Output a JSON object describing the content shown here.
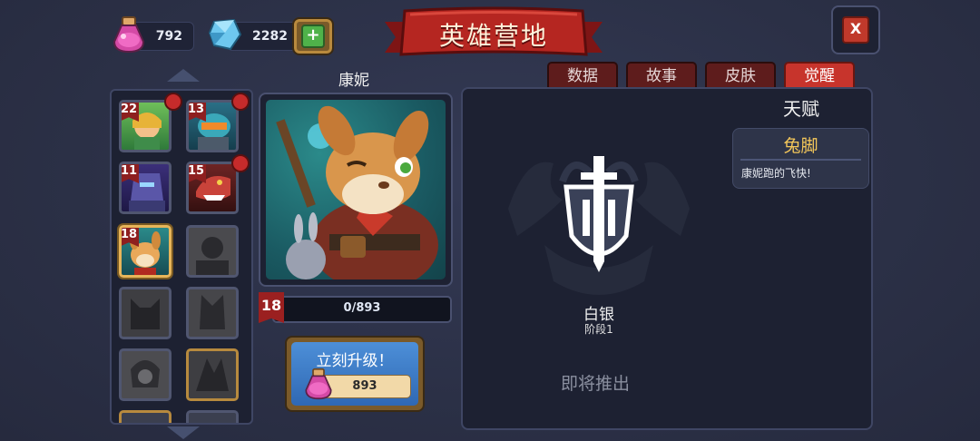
{
  "header": {
    "title": "英雄营地",
    "close_label": "X"
  },
  "currency": {
    "potion": {
      "value": "792",
      "icon": "potion-icon"
    },
    "gem": {
      "value": "2282",
      "icon": "gem-icon"
    },
    "add_label": "+"
  },
  "hero_list": {
    "slots": [
      {
        "level": "22",
        "badge": true,
        "state": "unlocked"
      },
      {
        "level": "13",
        "badge": true,
        "state": "unlocked"
      },
      {
        "level": "11",
        "badge": false,
        "state": "unlocked"
      },
      {
        "level": "15",
        "badge": true,
        "state": "unlocked"
      },
      {
        "level": "18",
        "badge": false,
        "state": "selected"
      },
      {
        "level": "",
        "badge": false,
        "state": "locked"
      },
      {
        "level": "",
        "badge": false,
        "state": "locked"
      },
      {
        "level": "",
        "badge": false,
        "state": "locked"
      },
      {
        "level": "",
        "badge": false,
        "state": "locked"
      },
      {
        "level": "",
        "badge": false,
        "state": "locked-gold"
      }
    ]
  },
  "hero": {
    "name": "康妮",
    "level": "18",
    "xp": "0/893"
  },
  "upgrade": {
    "label": "立刻升级！",
    "cost": "893"
  },
  "tabs": [
    {
      "label": "数据",
      "active": false
    },
    {
      "label": "故事",
      "active": false
    },
    {
      "label": "皮肤",
      "active": false
    },
    {
      "label": "觉醒",
      "active": true
    }
  ],
  "awakening": {
    "talent_header": "天赋",
    "talent_name": "兔脚",
    "talent_desc": "康妮跑的飞快!",
    "rank_name": "白银",
    "rank_stage": "阶段1",
    "coming_soon": "即将推出"
  },
  "colors": {
    "accent_red": "#c7342c",
    "talent_gold": "#f4c75a",
    "button_blue": "#3b7dc8"
  }
}
